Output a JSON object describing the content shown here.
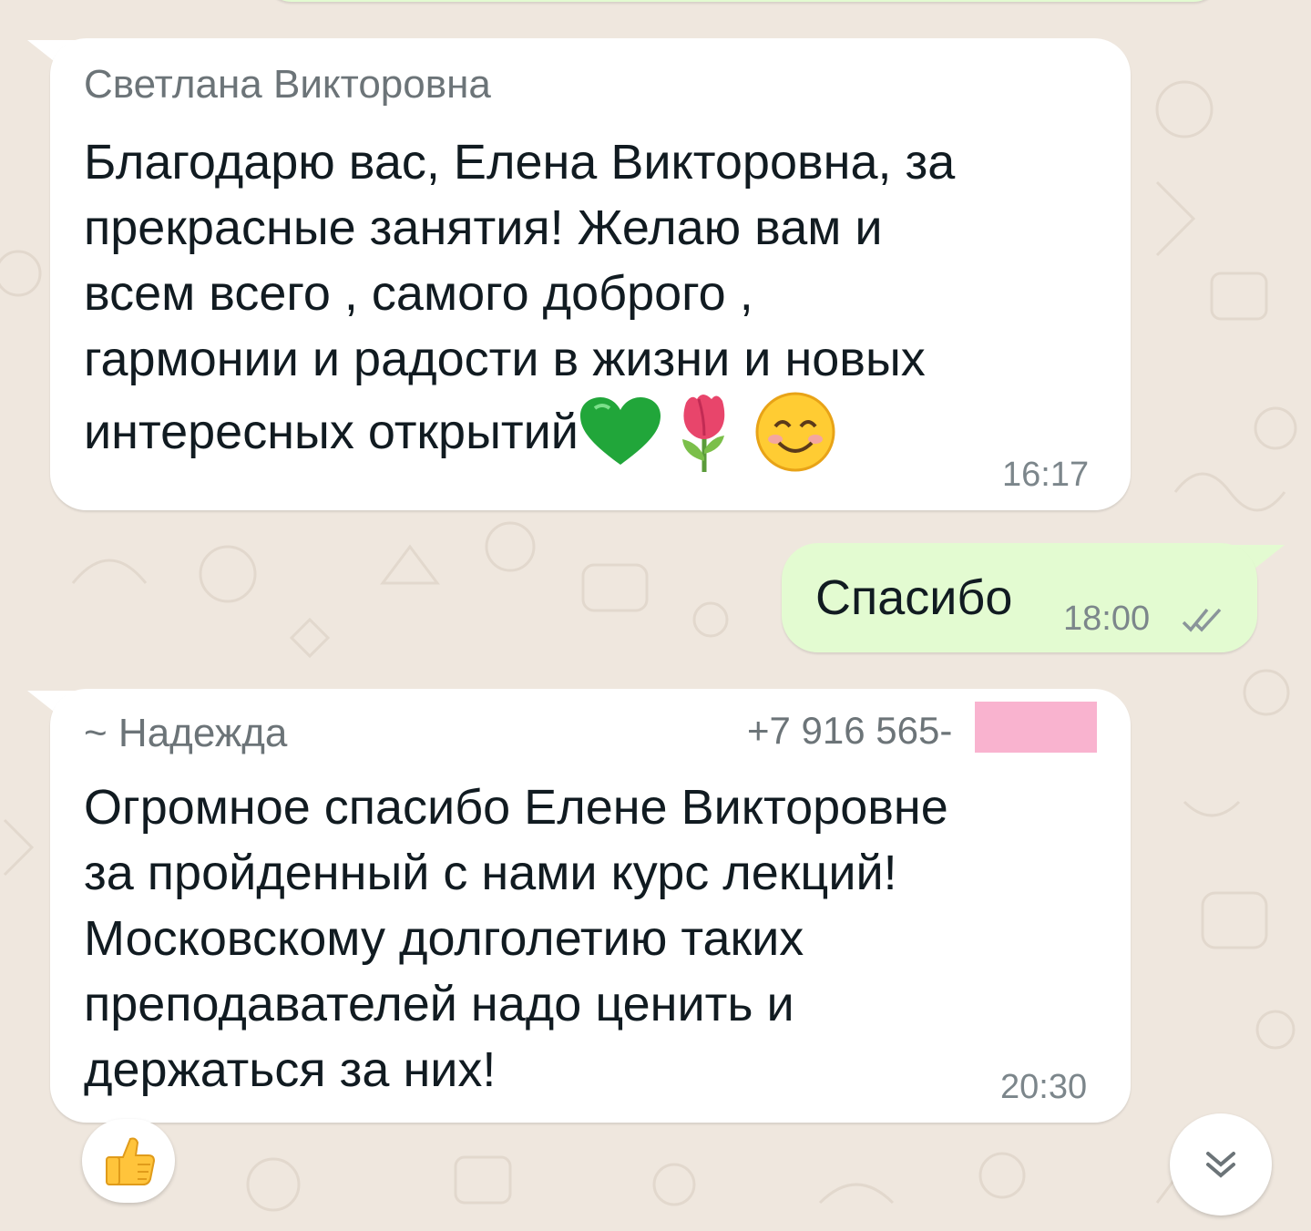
{
  "chat": {
    "messages": [
      {
        "sender": "Светлана Викторовна",
        "lines": [
          "Благодарю вас, Елена Викторовна, за",
          "прекрасные занятия! Желаю вам и",
          "всем всего , самого доброго ,",
          "гармонии и радости в жизни и новых",
          "интересных открытий"
        ],
        "emojis": [
          "green-heart-icon",
          "tulip-icon",
          "smiling-face-icon"
        ],
        "time": "16:17"
      },
      {
        "text": "Спасибо",
        "time": "18:00",
        "status": "double-check-icon"
      },
      {
        "sender": "~ Надежда",
        "phone": "+7 916 565-",
        "lines": [
          "Огромное спасибо  Елене  Викторовне",
          "за пройденный с нами курс лекций!",
          "Московскому долголетию таких",
          "преподавателей надо ценить и",
          "держаться за них!"
        ],
        "time": "20:30",
        "reaction": "thumbs-up-icon"
      }
    ],
    "scroll_button_icon": "double-chevron-down-icon"
  },
  "colors": {
    "background": "#efe7de",
    "incoming_bubble": "#ffffff",
    "outgoing_bubble": "#e3fbd1",
    "redaction": "#f9b3cf"
  }
}
